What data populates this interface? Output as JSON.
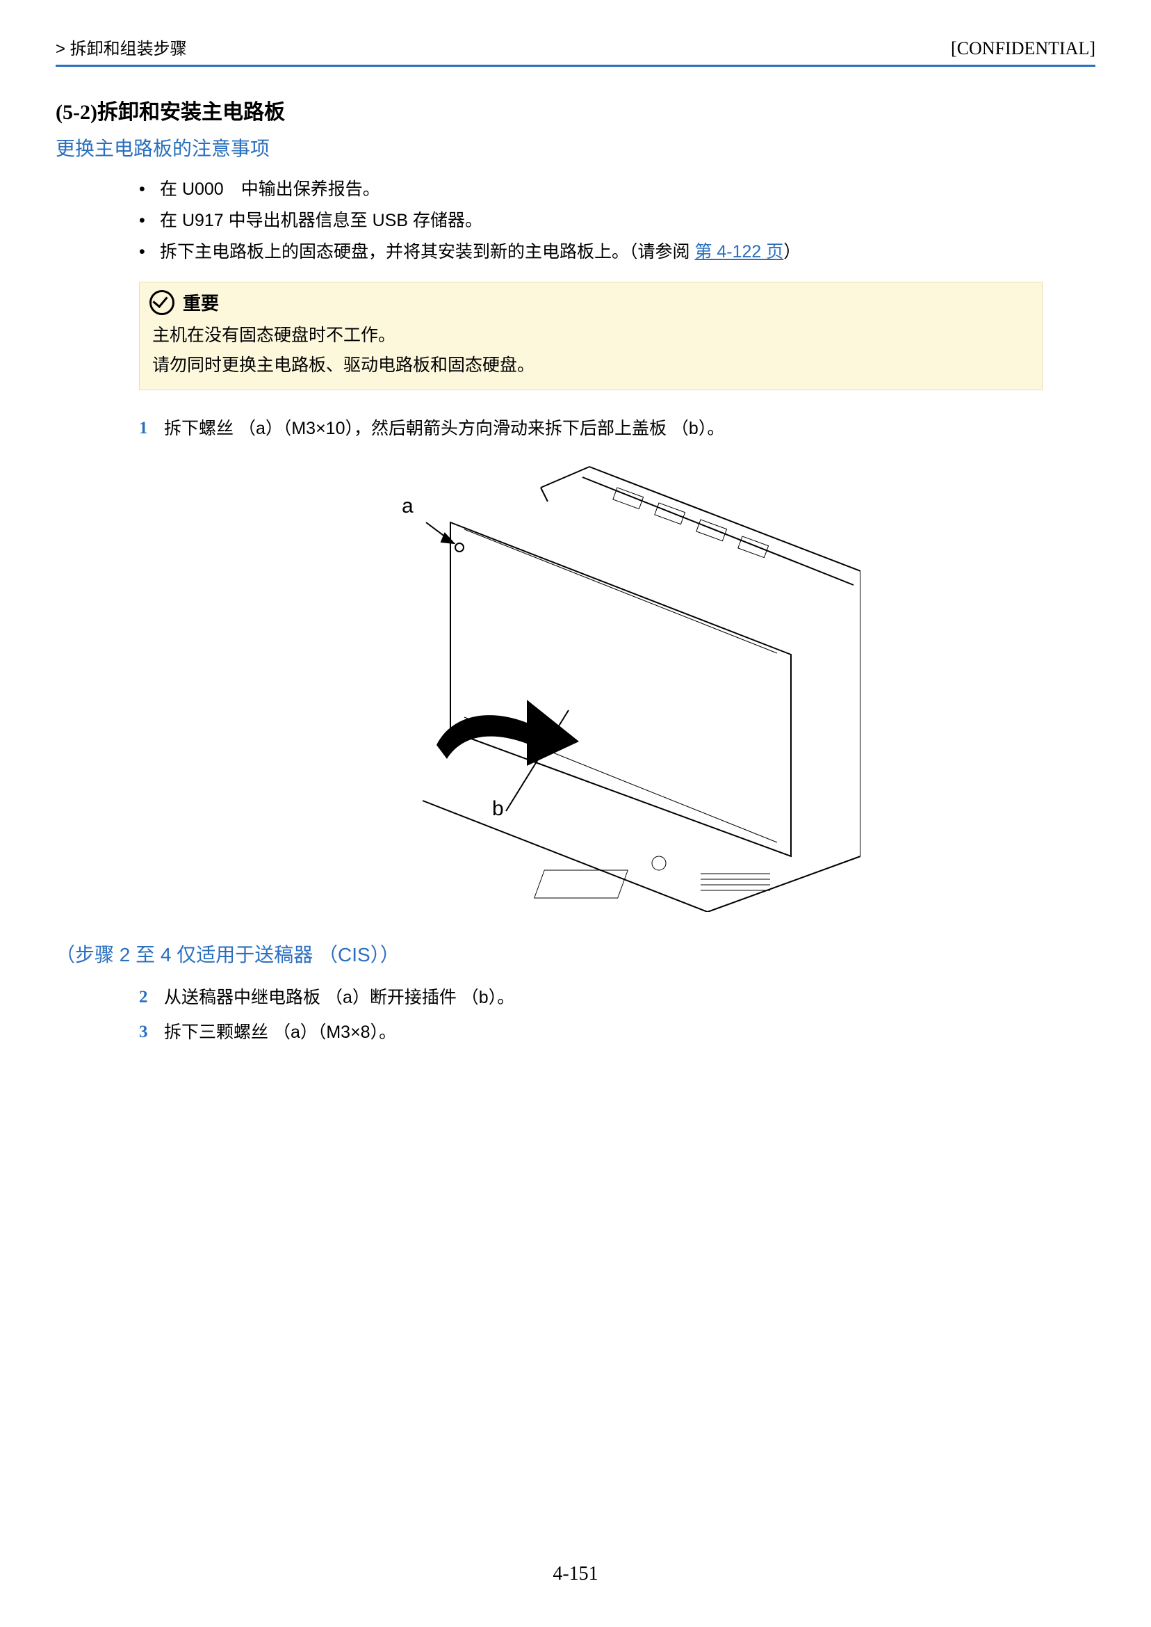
{
  "header": {
    "breadcrumb": " > 拆卸和组装步骤",
    "confidential": "[CONFIDENTIAL]"
  },
  "section": {
    "number_title": "(5-2)拆卸和安装主电路板",
    "subheading": "更换主电路板的注意事项"
  },
  "bullets": {
    "b1": "在 U000　中输出保养报告。",
    "b2": "在 U917 中导出机器信息至 USB 存储器。",
    "b3_pre": "拆下主电路板上的固态硬盘，并将其安装到新的主电路板上。（请参阅 ",
    "b3_link": "第 4-122 页",
    "b3_post": "）"
  },
  "note": {
    "title": "重要",
    "line1": "主机在没有固态硬盘时不工作。",
    "line2": "请勿同时更换主电路板、驱动电路板和固态硬盘。"
  },
  "steps": {
    "s1": "拆下螺丝 （a）（M3×10），然后朝箭头方向滑动来拆下后部上盖板 （b）。",
    "s2": "从送稿器中继电路板 （a）断开接插件 （b）。",
    "s3": "拆下三颗螺丝 （a）（M3×8）。"
  },
  "figure": {
    "label_a": "a",
    "label_b": "b"
  },
  "sub_section": {
    "title": "（步骤 2 至 4 仅适用于送稿器 （CIS））"
  },
  "page_number": "4-151"
}
